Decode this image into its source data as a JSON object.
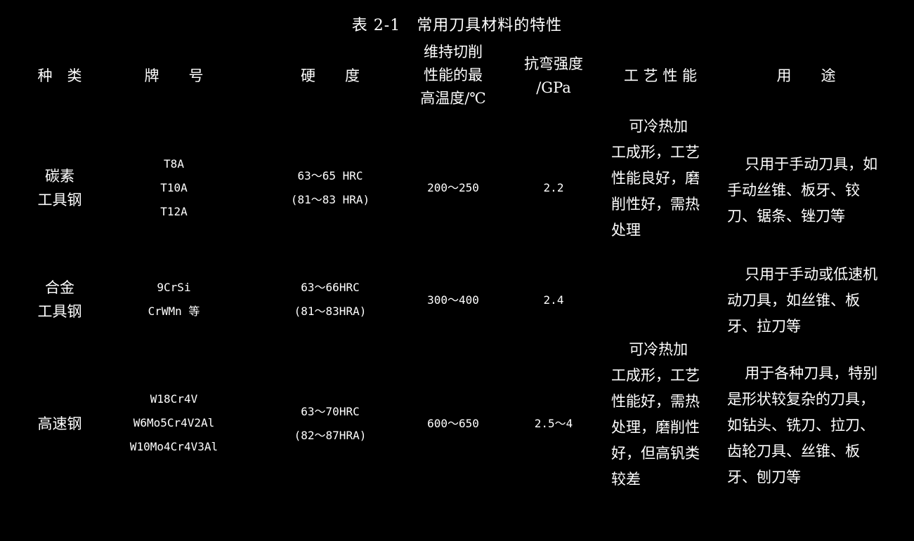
{
  "table": {
    "title": "表 2-1　常用刀具材料的特性",
    "headers": {
      "kind": "种　类",
      "grade": "牌　　号",
      "hardness": "硬　　度",
      "heat": "维持切削\n性能的最\n高温度/℃",
      "strength": "抗弯强度\n/GPa",
      "process": "工 艺 性 能",
      "use": "用　　途"
    },
    "rows": [
      {
        "kind": "碳素\n工具钢",
        "grade": "T8A\nT10A\nT12A",
        "hardness": "63～65 HRC\n(81～83 HRA)",
        "heat": "200～250",
        "strength": "2.2",
        "process": "可冷热加工成形，工艺性能良好，磨削性好，需热处理",
        "use": "只用于手动刀具，如手动丝锥、板牙、铰刀、锯条、锉刀等"
      },
      {
        "kind": "合金\n工具钢",
        "grade": "9CrSi\nCrWMn 等",
        "hardness": "63～66HRC\n(81～83HRA)",
        "heat": "300～400",
        "strength": "2.4",
        "process": "",
        "use": "只用于手动或低速机动刀具，如丝锥、板牙、拉刀等"
      },
      {
        "kind": "高速钢",
        "grade": "W18Cr4V\nW6Mo5Cr4V2Al\nW10Mo4Cr4V3Al",
        "hardness": "63～70HRC\n(82～87HRA)",
        "heat": "600～650",
        "strength": "2.5～4",
        "process": "可冷热加工成形，工艺性能好，需热处理，磨削性好，但高钒类较差",
        "use": "用于各种刀具，特别是形状较复杂的刀具，如钻头、铣刀、拉刀、齿轮刀具、丝锥、板牙、刨刀等"
      }
    ]
  }
}
